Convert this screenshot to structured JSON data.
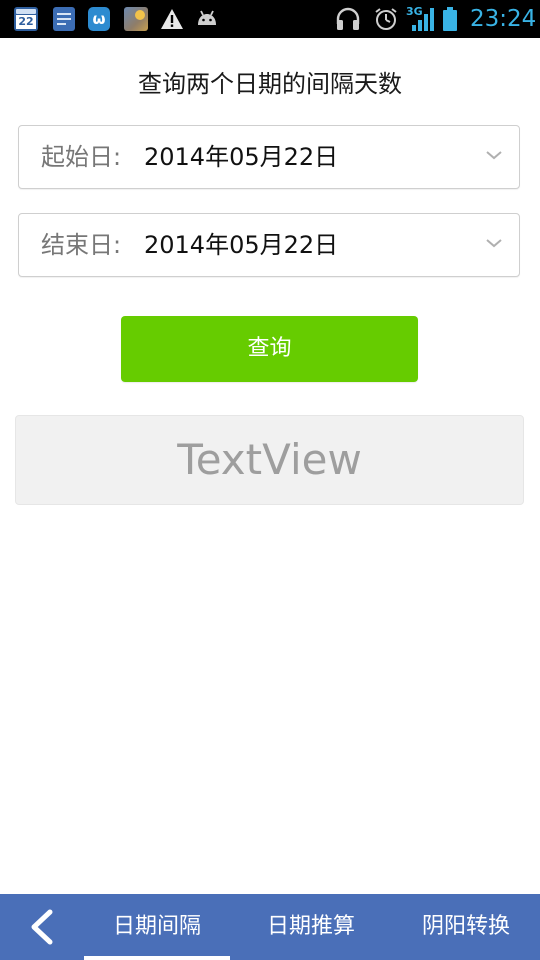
{
  "status_bar": {
    "calendar_icon_number": "22",
    "app_icon_glyph": "ω",
    "network_type": "3G",
    "time": "23:24",
    "accent_color": "#39b3e5",
    "icons": [
      "calendar-icon",
      "news-icon",
      "app-icon",
      "weather-icon",
      "warning-icon",
      "android-icon",
      "headphone-icon",
      "alarm-icon",
      "signal-icon",
      "battery-icon"
    ]
  },
  "page": {
    "title": "查询两个日期的间隔天数"
  },
  "start_date": {
    "label": "起始日:",
    "value": "2014年05月22日"
  },
  "end_date": {
    "label": "结束日:",
    "value": "2014年05月22日"
  },
  "query_button": {
    "label": "查询",
    "color": "#66cc00"
  },
  "result": {
    "text": "TextView"
  },
  "tab_bar": {
    "color": "#4a6fb8",
    "back_icon": "chevron-left-icon",
    "tabs": [
      {
        "label": "日期间隔",
        "selected": true
      },
      {
        "label": "日期推算",
        "selected": false
      },
      {
        "label": "阴阳转换",
        "selected": false
      }
    ]
  }
}
